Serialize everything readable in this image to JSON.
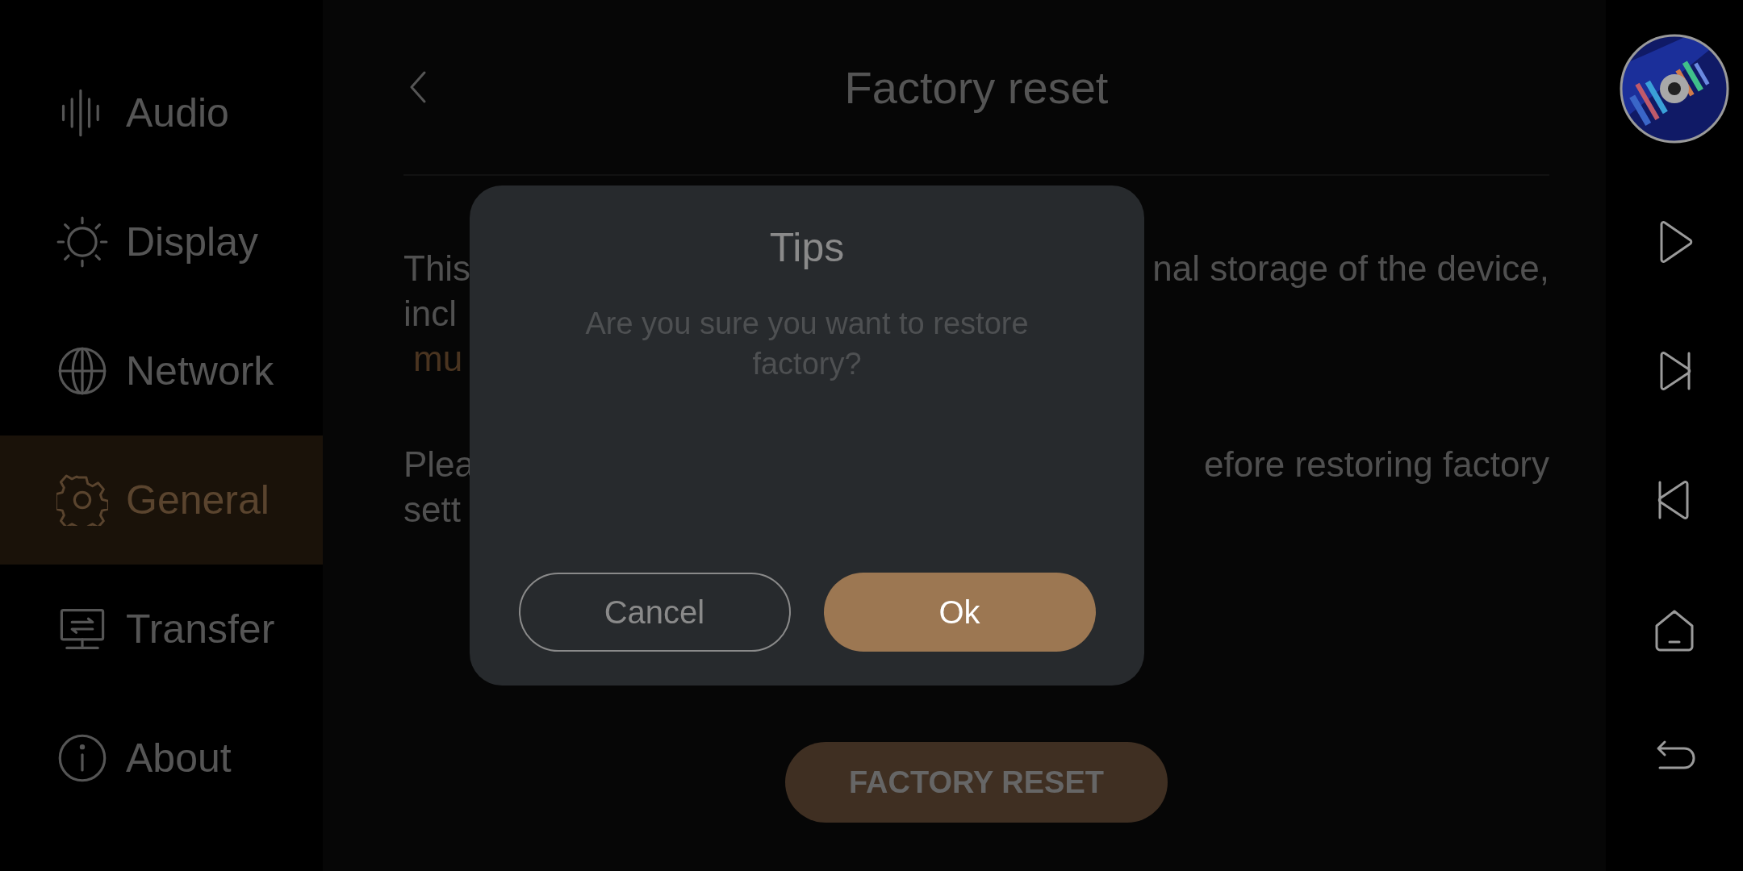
{
  "sidebar": {
    "items": [
      {
        "label": "Audio",
        "selected": false
      },
      {
        "label": "Display",
        "selected": false
      },
      {
        "label": "Network",
        "selected": false
      },
      {
        "label": "General",
        "selected": true
      },
      {
        "label": "Transfer",
        "selected": false
      },
      {
        "label": "About",
        "selected": false
      }
    ]
  },
  "page": {
    "title": "Factory reset",
    "paragraphs": [
      {
        "lines": [
          {
            "start": "This",
            "end": "nal storage of the device,",
            "highlight": false
          },
          {
            "start": "incl",
            "highlight": false
          },
          {
            "start": "mu",
            "highlight": true
          }
        ]
      },
      {
        "lines": [
          {
            "start": "Plea",
            "end": "efore restoring factory",
            "highlight": false
          },
          {
            "start": "sett",
            "highlight": false
          }
        ]
      }
    ],
    "action": "FACTORY RESET"
  },
  "dialog": {
    "title": "Tips",
    "message": "Are you sure you want to restore factory?",
    "buttons": [
      {
        "label": "Cancel",
        "kind": "secondary"
      },
      {
        "label": "Ok",
        "kind": "primary"
      }
    ]
  }
}
